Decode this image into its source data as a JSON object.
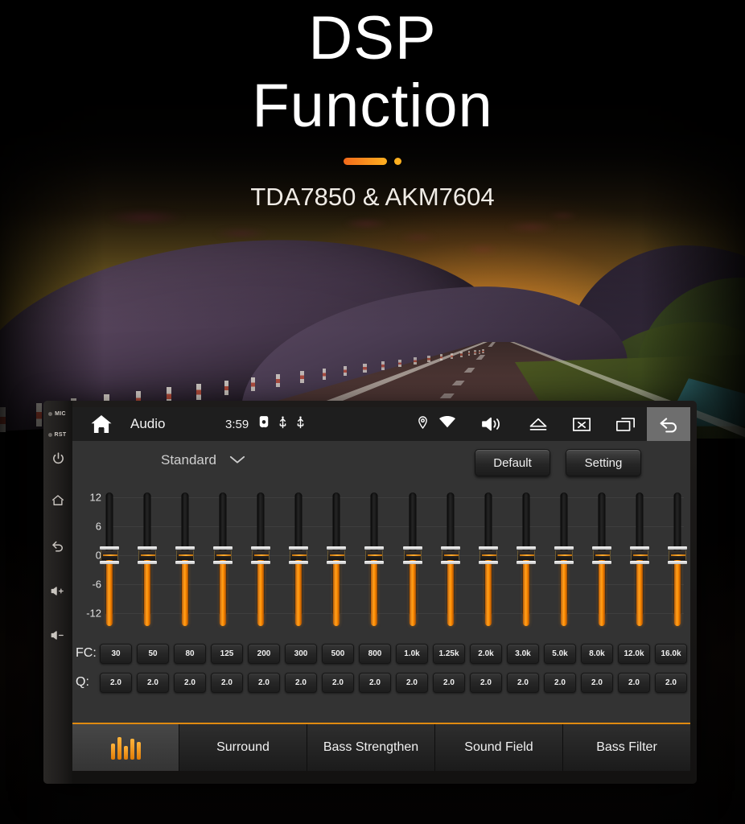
{
  "hero": {
    "title_line1": "DSP",
    "title_line2": "Function",
    "subtitle": "TDA7850 & AKM7604",
    "accent_color": "#f58220",
    "dot_color": "#ffb020"
  },
  "bezel": {
    "mic_label": "MIC",
    "rst_label": "RST",
    "buttons": [
      {
        "name": "power-icon"
      },
      {
        "name": "home-icon"
      },
      {
        "name": "back-icon"
      },
      {
        "name": "volume-up-icon"
      },
      {
        "name": "volume-down-icon"
      }
    ]
  },
  "statusbar": {
    "home_icon": "home-icon",
    "title": "Audio",
    "time": "3:59",
    "mini_icons": [
      "sd-card-icon",
      "usb-icon",
      "usb-icon"
    ],
    "right_icons": [
      "location-pin-icon",
      "wifi-icon",
      "volume-icon",
      "eject-icon",
      "close-box-icon",
      "multi-window-icon"
    ],
    "back_icon": "back-arrow-icon",
    "back_active": true
  },
  "toolbar": {
    "preset_label": "Standard",
    "preset_caret": "chevron-down-icon",
    "default_label": "Default",
    "setting_label": "Setting"
  },
  "equalizer": {
    "axis_labels": [
      "12",
      "6",
      "0",
      "-6",
      "-12"
    ],
    "axis_min": -12,
    "axis_max": 12,
    "fc_label": "FC:",
    "q_label": "Q:",
    "bands": [
      {
        "fc": "30",
        "q": "2.0",
        "gain": 0
      },
      {
        "fc": "50",
        "q": "2.0",
        "gain": 0
      },
      {
        "fc": "80",
        "q": "2.0",
        "gain": 0
      },
      {
        "fc": "125",
        "q": "2.0",
        "gain": 0
      },
      {
        "fc": "200",
        "q": "2.0",
        "gain": 0
      },
      {
        "fc": "300",
        "q": "2.0",
        "gain": 0
      },
      {
        "fc": "500",
        "q": "2.0",
        "gain": 0
      },
      {
        "fc": "800",
        "q": "2.0",
        "gain": 0
      },
      {
        "fc": "1.0k",
        "q": "2.0",
        "gain": 0
      },
      {
        "fc": "1.25k",
        "q": "2.0",
        "gain": 0
      },
      {
        "fc": "2.0k",
        "q": "2.0",
        "gain": 0
      },
      {
        "fc": "3.0k",
        "q": "2.0",
        "gain": 0
      },
      {
        "fc": "5.0k",
        "q": "2.0",
        "gain": 0
      },
      {
        "fc": "8.0k",
        "q": "2.0",
        "gain": 0
      },
      {
        "fc": "12.0k",
        "q": "2.0",
        "gain": 0
      },
      {
        "fc": "16.0k",
        "q": "2.0",
        "gain": 0
      }
    ]
  },
  "tabs": [
    {
      "label": "",
      "icon": "equalizer-icon",
      "active": true
    },
    {
      "label": "Surround",
      "icon": "",
      "active": false
    },
    {
      "label": "Bass Strengthen",
      "icon": "",
      "active": false
    },
    {
      "label": "Sound Field",
      "icon": "",
      "active": false
    },
    {
      "label": "Bass Filter",
      "icon": "",
      "active": false
    }
  ]
}
